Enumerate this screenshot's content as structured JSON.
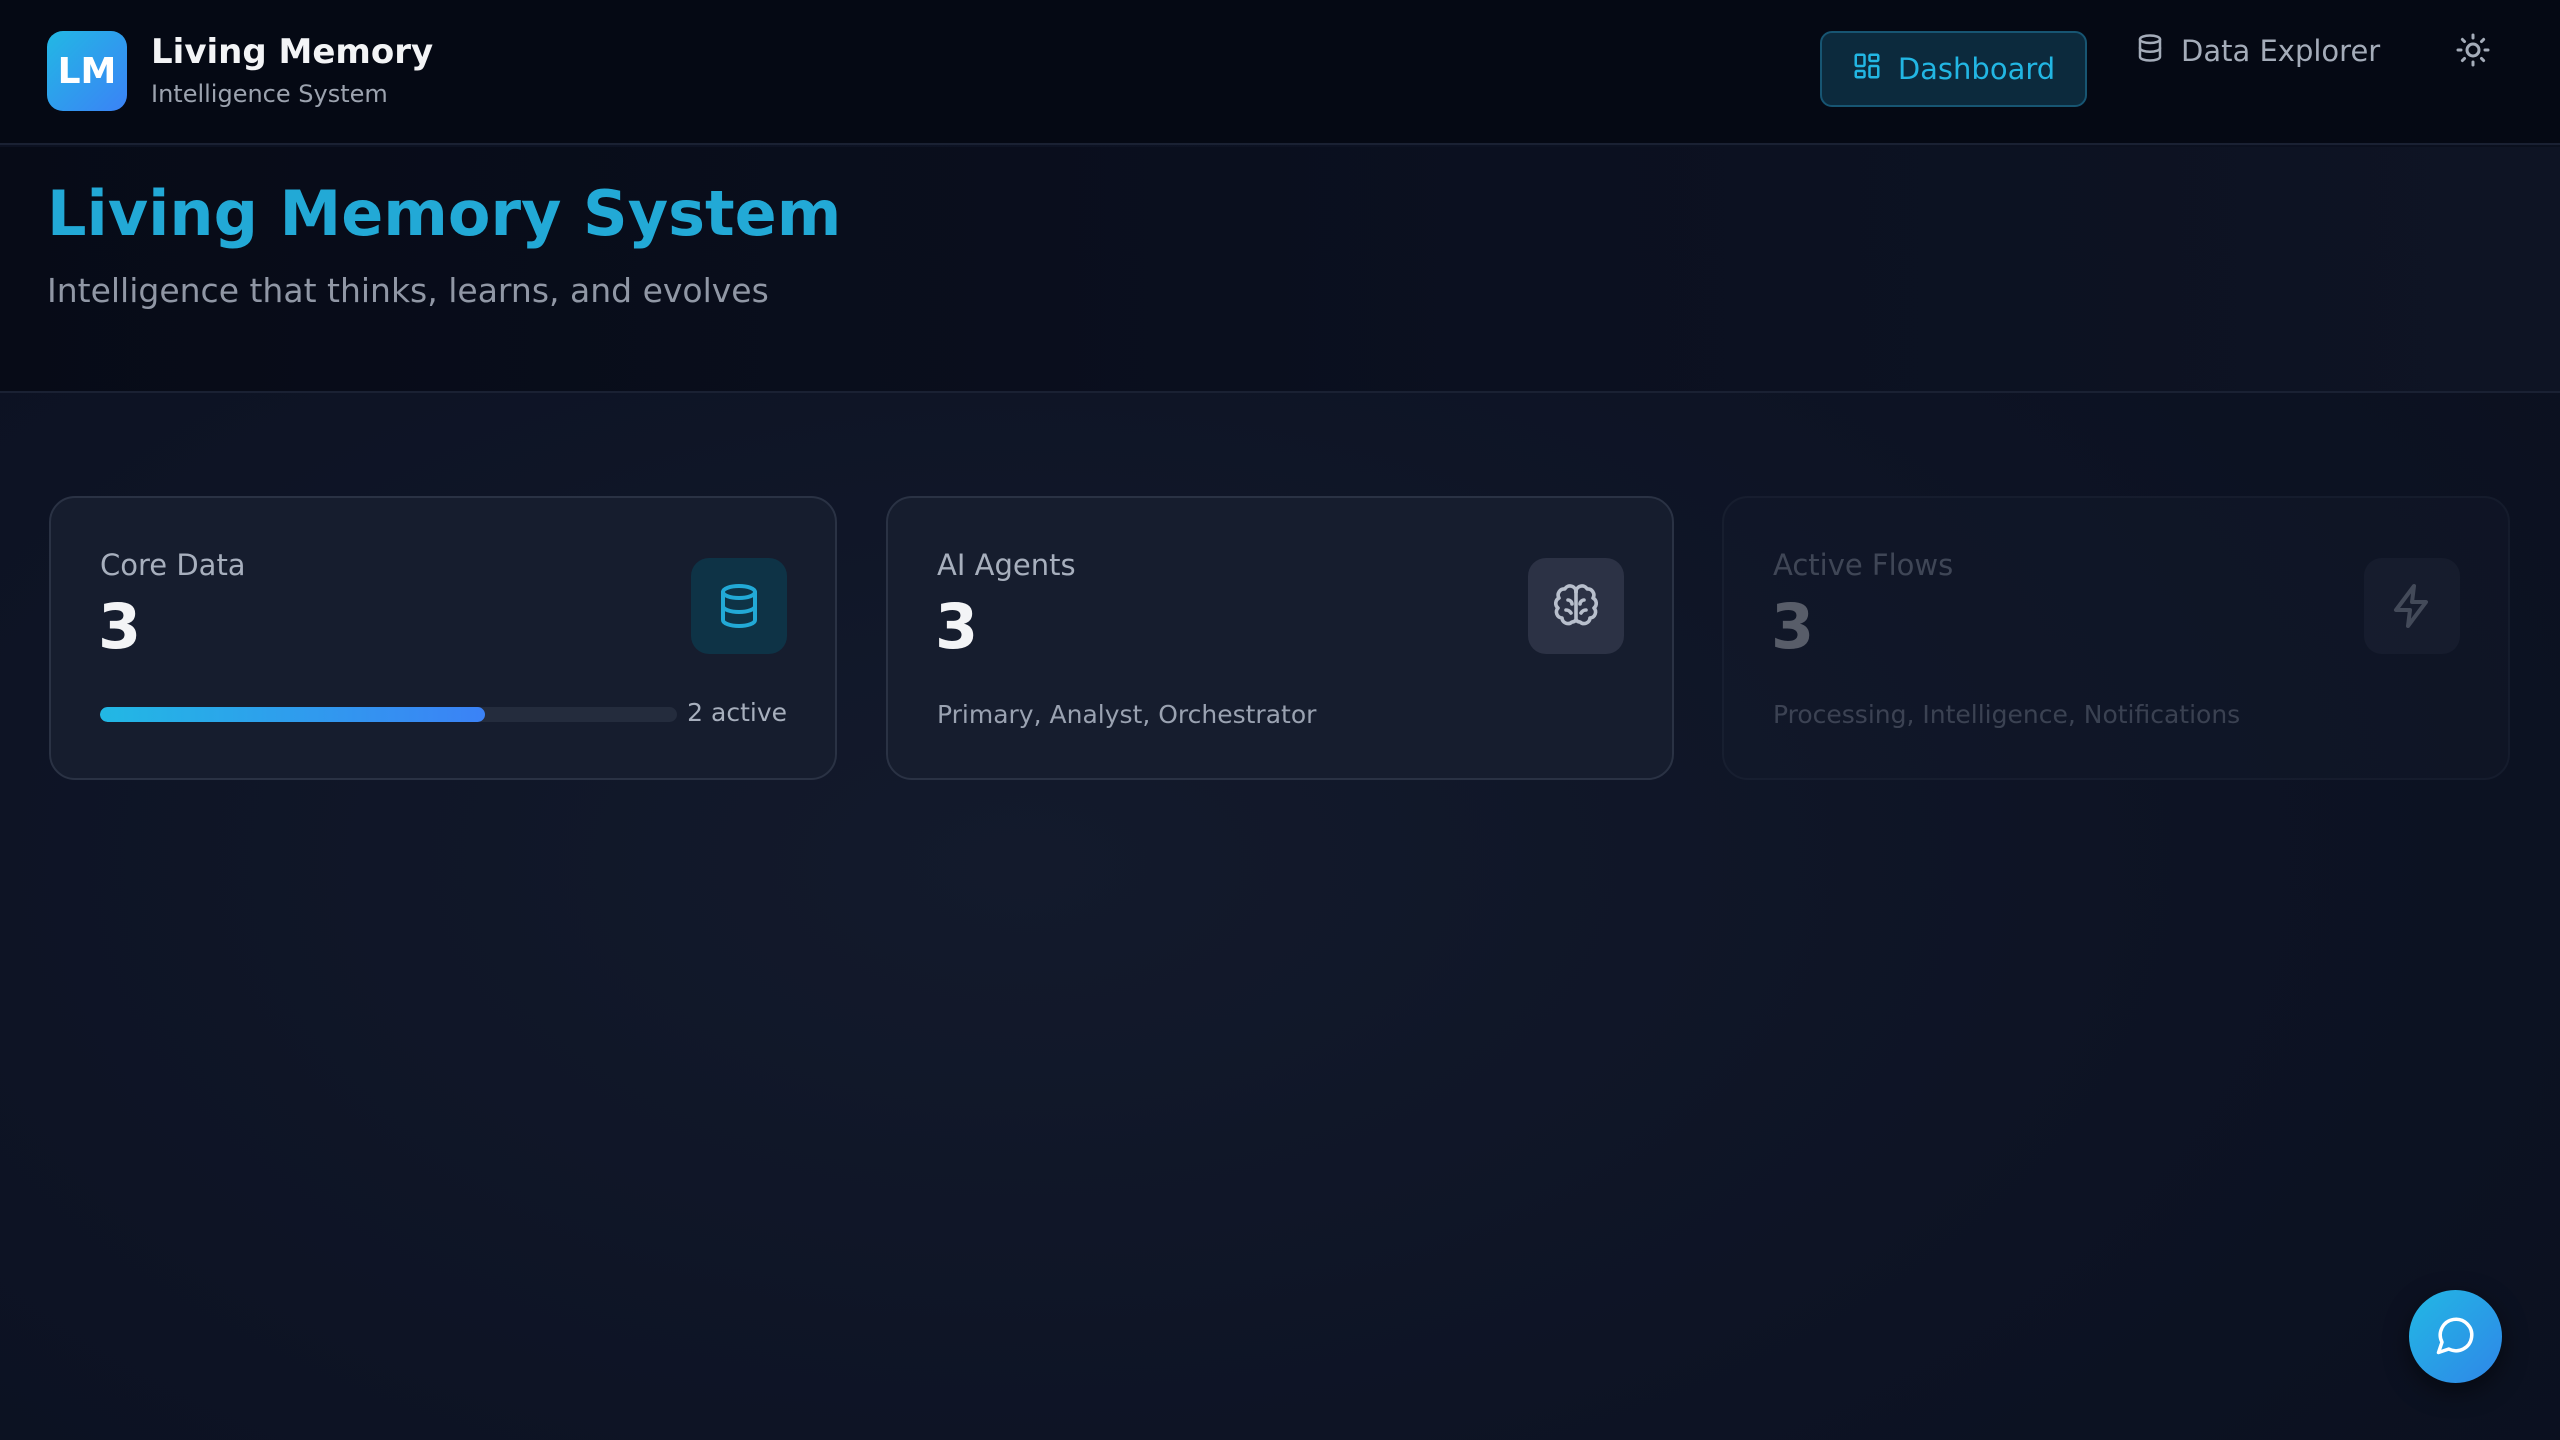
{
  "brand": {
    "logo_text": "LM",
    "title": "Living Memory",
    "subtitle": "Intelligence System"
  },
  "nav": {
    "dashboard_label": "Dashboard",
    "data_explorer_label": "Data Explorer",
    "active": "Dashboard"
  },
  "hero": {
    "title": "Living Memory System",
    "subtitle": "Intelligence that thinks, learns, and evolves"
  },
  "cards": [
    {
      "label": "Core Data",
      "value": "3",
      "icon": "database-icon",
      "progress": 0.667,
      "progress_text": "2 active"
    },
    {
      "label": "AI Agents",
      "value": "3",
      "icon": "brain-icon",
      "description": "Primary, Analyst, Orchestrator"
    },
    {
      "label": "Active Flows",
      "value": "3",
      "icon": "zap-icon",
      "description": "Processing, Intelligence, Notifications"
    }
  ],
  "icons": {
    "theme_toggle": "sun-icon",
    "chat": "message-circle-icon"
  },
  "colors": {
    "accent": "#22b6e3",
    "accent_gradient_end": "#3b82f6",
    "background": "#0d1324",
    "card_background": "#161d2e"
  }
}
